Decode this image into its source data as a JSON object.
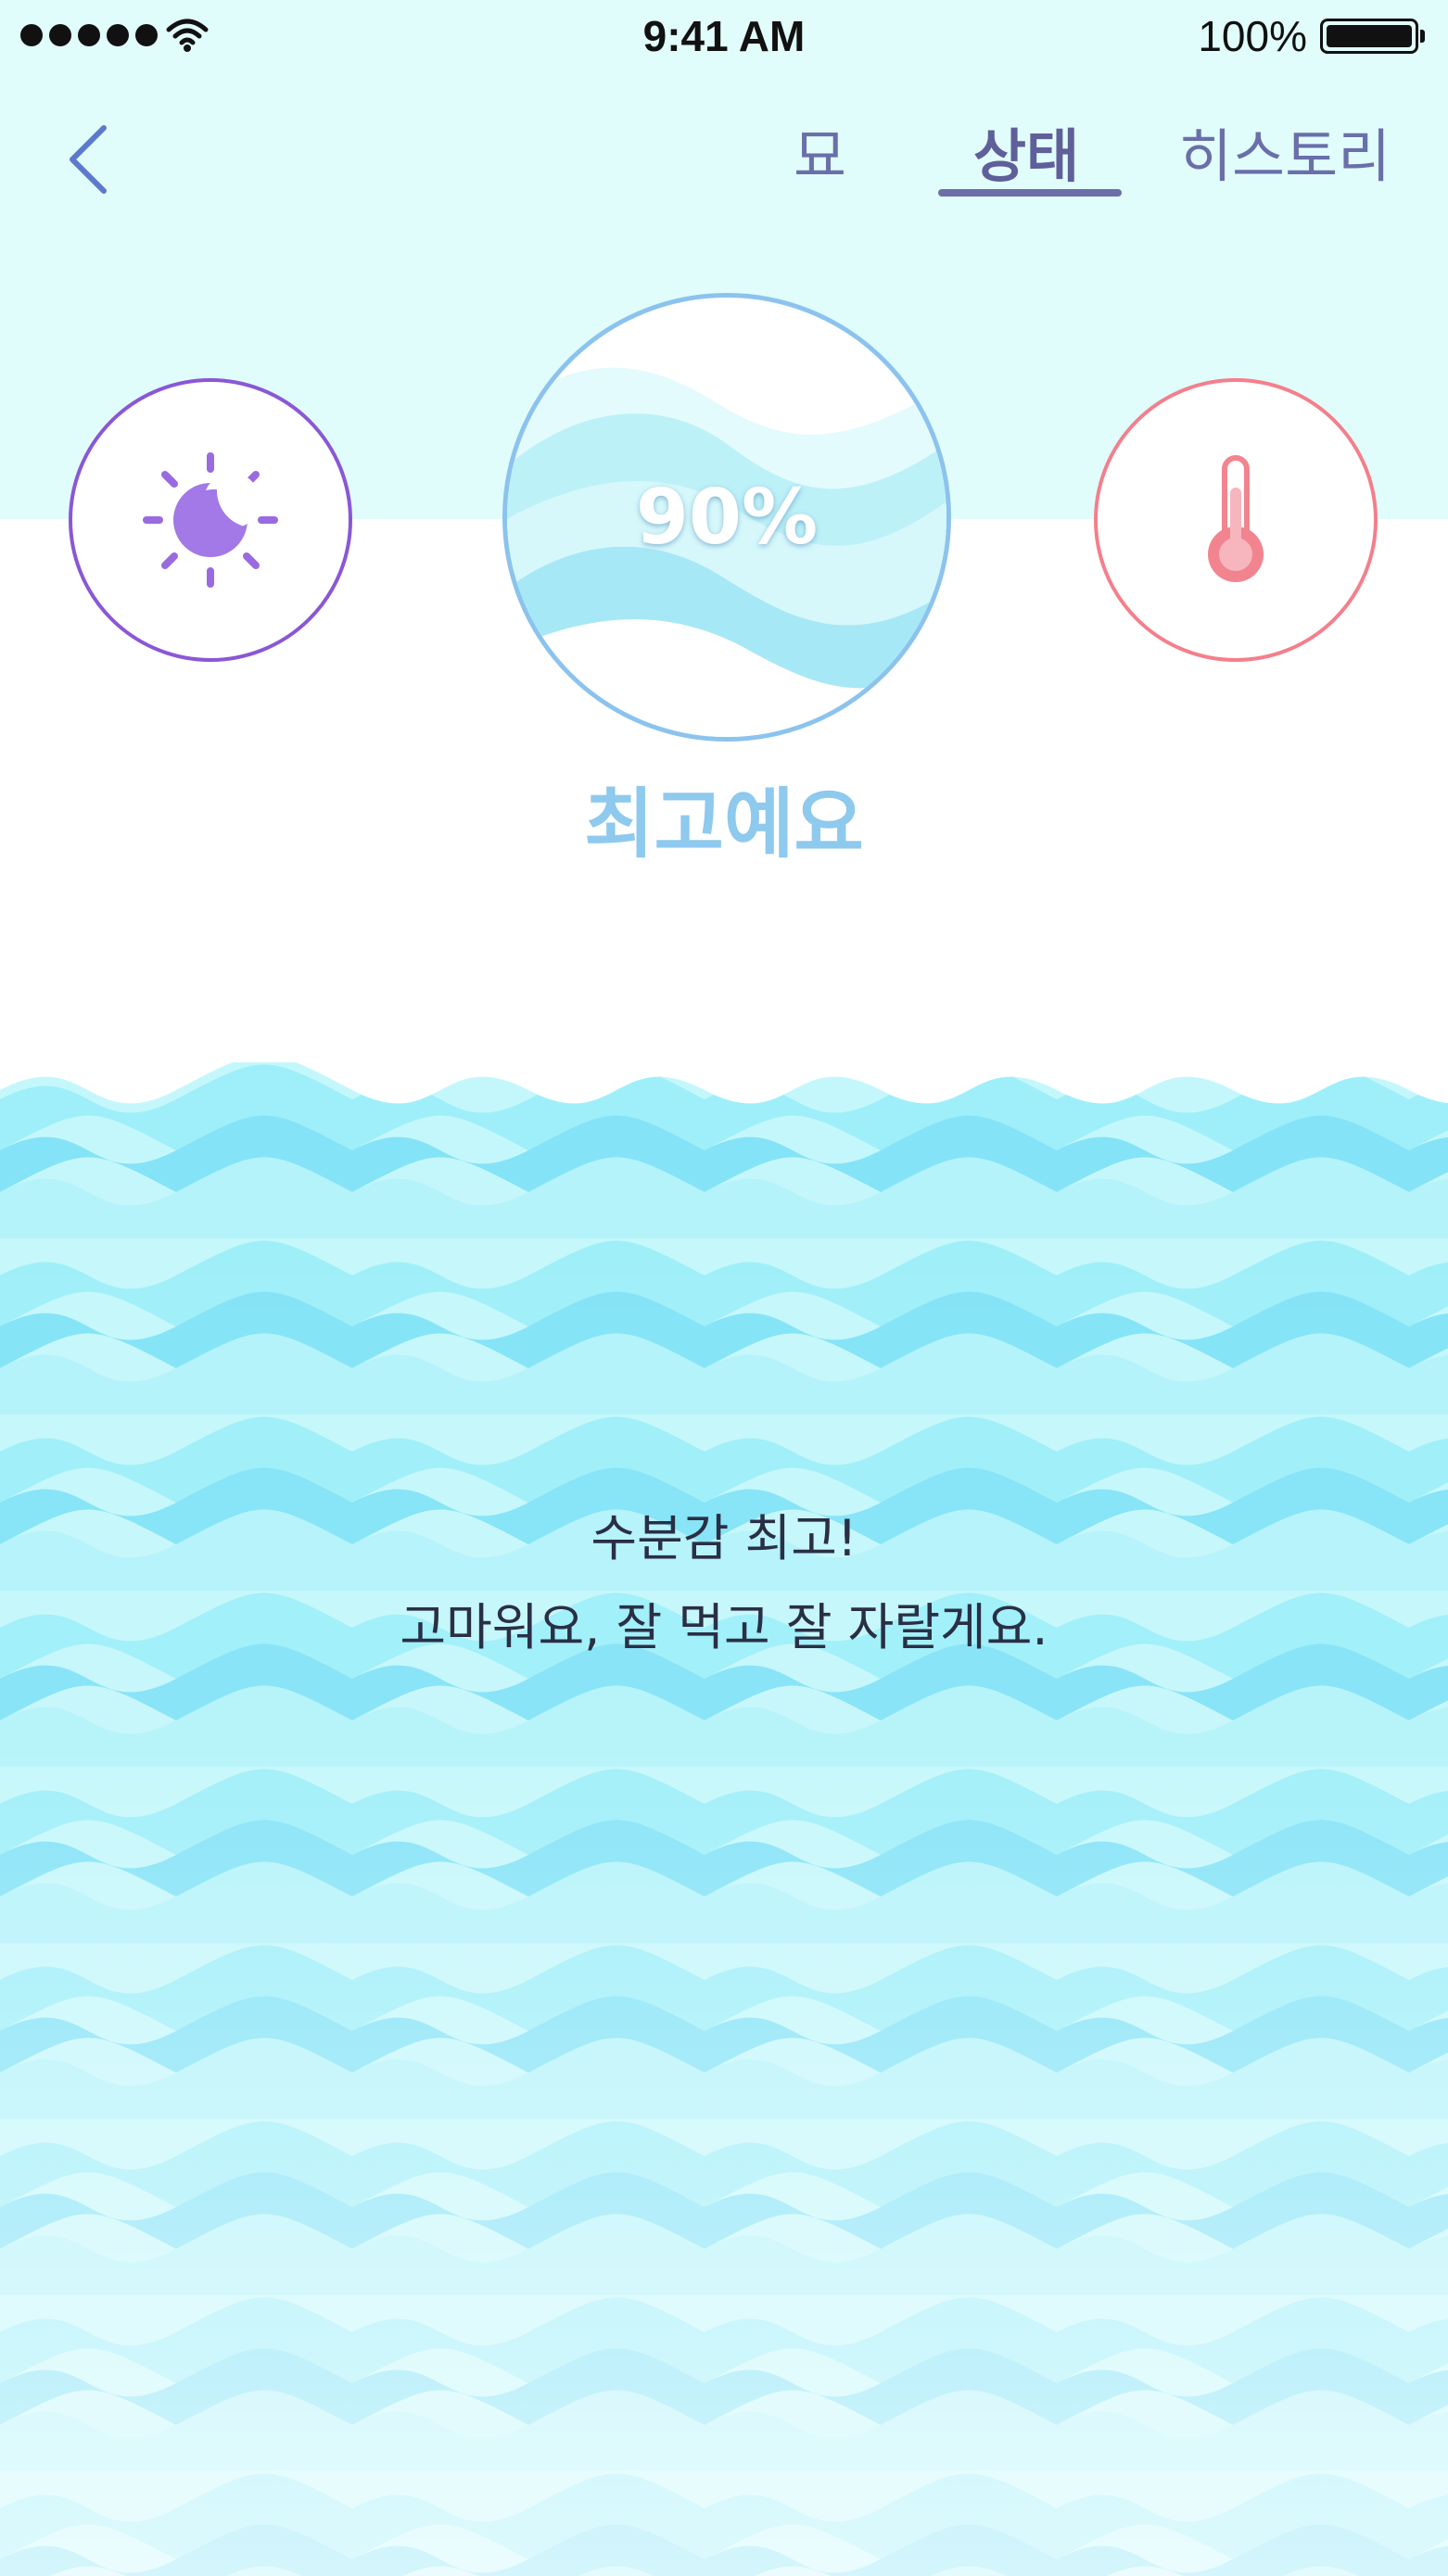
{
  "status_bar": {
    "time": "9:41 AM",
    "battery": "100%",
    "icons": [
      "signal-dots-icon",
      "wifi-icon",
      "battery-icon"
    ]
  },
  "nav": {
    "back_icon": "chevron-left-icon",
    "tabs": [
      {
        "label": "묘"
      },
      {
        "label": "상태",
        "active": true
      },
      {
        "label": "히스토리"
      }
    ]
  },
  "sensors": {
    "light": {
      "icon": "sun-moon-icon",
      "color": "#8a57d6"
    },
    "moisture": {
      "value": "90%",
      "level": 0.9,
      "status": "최고예요",
      "color": "#8ec9ee"
    },
    "temperature": {
      "icon": "thermometer-icon",
      "color": "#f47f8c"
    }
  },
  "message": {
    "line1": "수분감 최고!",
    "line2": "고마워요, 잘 먹고 잘 자랄게요."
  },
  "colors": {
    "header_bg": "#e1fdfb",
    "accent": "#6e6ea8",
    "wave": "#8ef3fb"
  }
}
